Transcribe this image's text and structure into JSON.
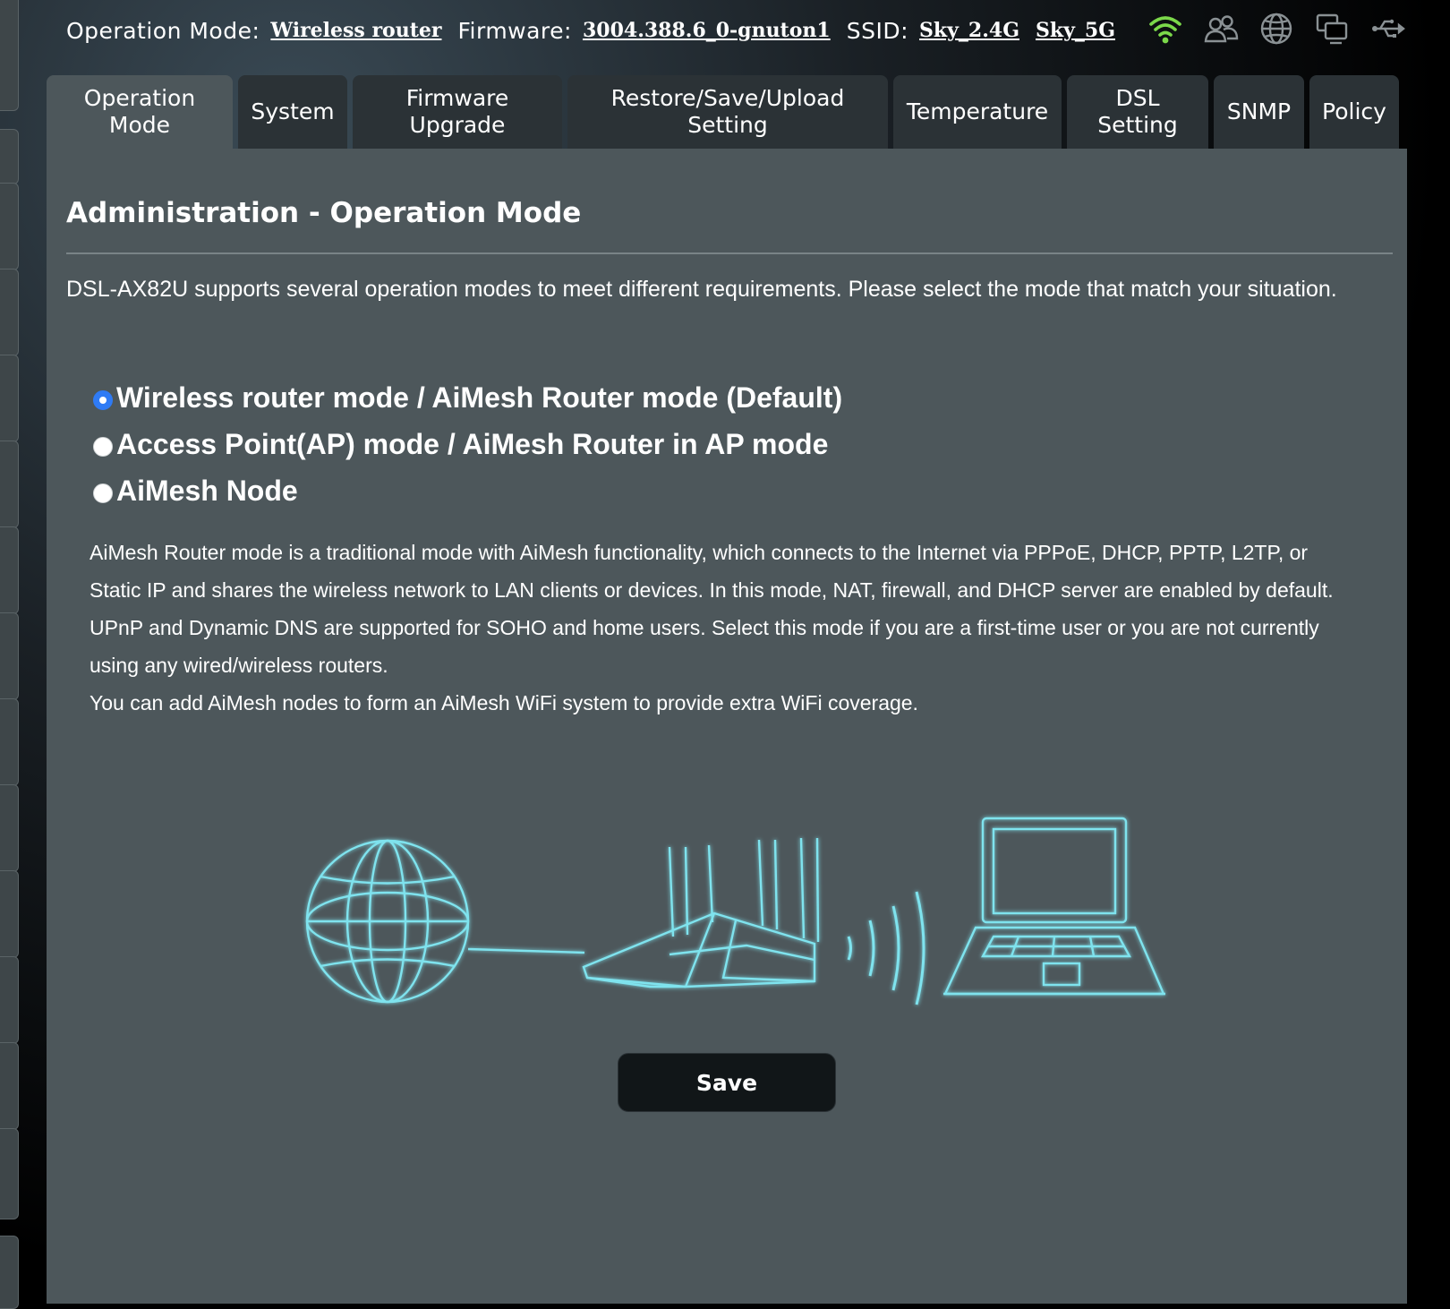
{
  "topbar": {
    "operation_mode_label": "Operation Mode:",
    "operation_mode_value": "Wireless router",
    "firmware_label": "Firmware:",
    "firmware_value": "3004.388.6_0-gnuton1",
    "ssid_label": "SSID:",
    "ssid_values": [
      "Sky_2.4G",
      "Sky_5G"
    ],
    "status_icons": [
      "wifi-signal-icon",
      "clients-icon",
      "internet-globe-icon",
      "devices-icon",
      "usb-icon"
    ],
    "wifi_icon_color": "#7bd84a"
  },
  "tabs": [
    {
      "label": "Operation\nMode",
      "active": true
    },
    {
      "label": "System",
      "active": false
    },
    {
      "label": "Firmware\nUpgrade",
      "active": false
    },
    {
      "label": "Restore/Save/Upload\nSetting",
      "active": false
    },
    {
      "label": "Temperature",
      "active": false
    },
    {
      "label": "DSL\nSetting",
      "active": false
    },
    {
      "label": "SNMP",
      "active": false
    },
    {
      "label": "Policy",
      "active": false
    }
  ],
  "main": {
    "title": "Administration - Operation Mode",
    "description": "DSL-AX82U supports several operation modes to meet different requirements. Please select the mode that match your situation.",
    "modes": [
      {
        "label": "Wireless router mode / AiMesh Router mode (Default)",
        "selected": true
      },
      {
        "label": "Access Point(AP) mode / AiMesh Router in AP mode",
        "selected": false
      },
      {
        "label": "AiMesh Node",
        "selected": false
      }
    ],
    "mode_help": {
      "paragraph1": "AiMesh Router mode is a traditional mode with AiMesh functionality, which connects to the Internet via PPPoE, DHCP, PPTP, L2TP, or Static IP and shares the wireless network to LAN clients or devices. In this mode, NAT, firewall, and DHCP server are enabled by default. UPnP and Dynamic DNS are supported for SOHO and home users. Select this mode if you are a first-time user or you are not currently using any wired/wireless routers.",
      "paragraph2": "You can add AiMesh nodes to form an AiMesh WiFi system to provide extra WiFi coverage."
    },
    "illustration_color": "#7fe3ee",
    "save_label": "Save"
  },
  "colors": {
    "panel": "#4d575b",
    "tab": "#2b3236",
    "radio_selected": "#2f7bf5"
  }
}
